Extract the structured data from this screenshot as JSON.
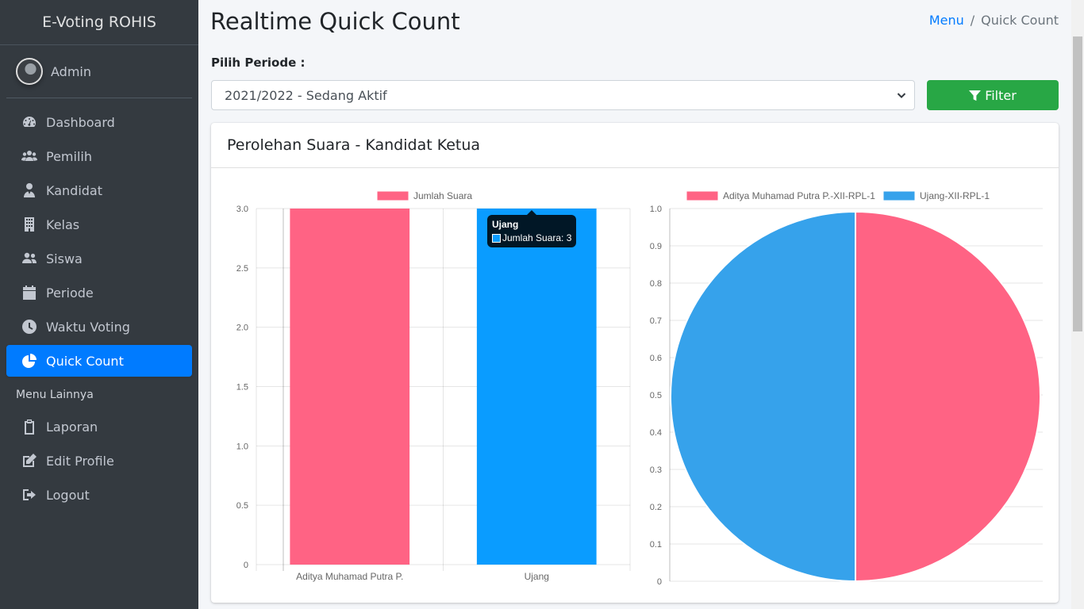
{
  "sidebar": {
    "brand": "E-Voting ROHIS",
    "user": "Admin",
    "items": [
      {
        "label": "Dashboard",
        "icon": "dashboard-icon"
      },
      {
        "label": "Pemilih",
        "icon": "users-icon"
      },
      {
        "label": "Kandidat",
        "icon": "user-tie-icon"
      },
      {
        "label": "Kelas",
        "icon": "building-icon"
      },
      {
        "label": "Siswa",
        "icon": "user-friends-icon"
      },
      {
        "label": "Periode",
        "icon": "calendar-icon"
      },
      {
        "label": "Waktu Voting",
        "icon": "clock-icon"
      },
      {
        "label": "Quick Count",
        "icon": "chart-pie-icon",
        "active": true
      }
    ],
    "section_header": "Menu Lainnya",
    "other_items": [
      {
        "label": "Laporan",
        "icon": "clipboard-icon"
      },
      {
        "label": "Edit Profile",
        "icon": "edit-icon"
      },
      {
        "label": "Logout",
        "icon": "sign-out-icon"
      }
    ]
  },
  "header": {
    "title": "Realtime Quick Count",
    "breadcrumb": {
      "home": "Menu",
      "current": "Quick Count"
    }
  },
  "filter": {
    "label": "Pilih Periode :",
    "selected": "2021/2022 - Sedang Aktif",
    "button": "Filter"
  },
  "card": {
    "title": "Perolehan Suara - Kandidat Ketua"
  },
  "colors": {
    "pink": "#ff6384",
    "blue": "#36a2eb",
    "blue_hover": "#0a9cff",
    "accent": "#007bff",
    "success": "#28a745"
  },
  "tooltip": {
    "title": "Ujang",
    "body": "Jumlah Suara: 3"
  },
  "chart_data": [
    {
      "type": "bar",
      "legend": [
        "Jumlah Suara"
      ],
      "legend_position": "top",
      "categories": [
        "Aditya Muhamad Putra P.",
        "Ujang"
      ],
      "series": [
        {
          "name": "Jumlah Suara",
          "values": [
            3,
            3
          ]
        }
      ],
      "bar_colors": [
        "#ff6384",
        "#0a9cff"
      ],
      "ylim": [
        0,
        3
      ],
      "yticks": [
        "0",
        "0.5",
        "1.0",
        "1.5",
        "2.0",
        "2.5",
        "3.0"
      ],
      "grid": true
    },
    {
      "type": "pie",
      "legend": [
        "Aditya Muhamad Putra P.-XII-RPL-1",
        "Ujang-XII-RPL-1"
      ],
      "legend_position": "top",
      "slices": [
        {
          "label": "Aditya Muhamad Putra P.-XII-RPL-1",
          "value": 3,
          "color": "#ff6384"
        },
        {
          "label": "Ujang-XII-RPL-1",
          "value": 3,
          "color": "#36a2eb"
        }
      ],
      "background_axis": {
        "ylim": [
          0,
          1
        ],
        "yticks": [
          "0",
          "0.1",
          "0.2",
          "0.3",
          "0.4",
          "0.5",
          "0.6",
          "0.7",
          "0.8",
          "0.9",
          "1.0"
        ]
      }
    }
  ]
}
